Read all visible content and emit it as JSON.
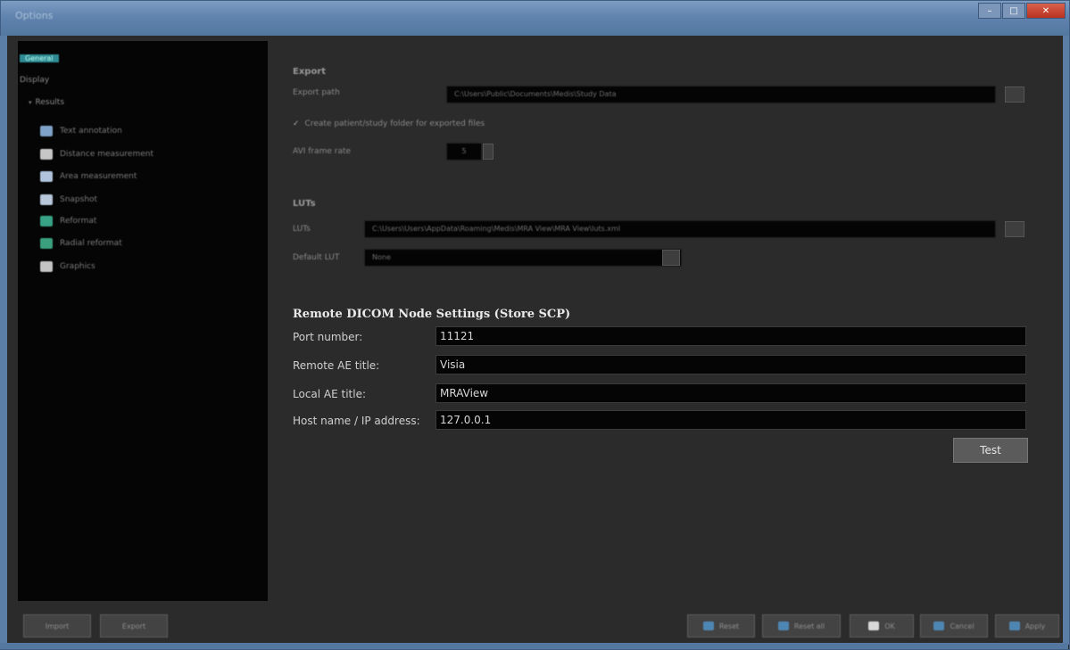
{
  "window": {
    "title": "Options"
  },
  "sidebar": {
    "top_items": [
      {
        "label": "General"
      },
      {
        "label": "Display"
      },
      {
        "label": "Results"
      }
    ],
    "sub_items": [
      {
        "label": "Text annotation",
        "icon": "text-annotation-icon",
        "color": "#7fa3c8"
      },
      {
        "label": "Distance measurement",
        "icon": "ruler-icon",
        "color": "#c7c7c7"
      },
      {
        "label": "Area measurement",
        "icon": "area-icon",
        "color": "#b0c4dc"
      },
      {
        "label": "Snapshot",
        "icon": "snapshot-icon",
        "color": "#b8c8da"
      },
      {
        "label": "Reformat",
        "icon": "reformat-icon",
        "color": "#38a386"
      },
      {
        "label": "Radial reformat",
        "icon": "radial-reformat-icon",
        "color": "#3aa07e"
      },
      {
        "label": "Graphics",
        "icon": "graphics-icon",
        "color": "#c4c4c4"
      }
    ]
  },
  "export": {
    "section_title": "Export",
    "path_label": "Export path",
    "path_value": "C:\\Users\\Public\\Documents\\Medis\\Study Data",
    "checkbox_label": "Create patient/study folder for exported files",
    "fps_label": "AVI frame rate",
    "fps_value": "5"
  },
  "luts": {
    "section_title": "LUTs",
    "luts_label": "LUTs",
    "luts_value": "C:\\Users\\Users\\AppData\\Roaming\\Medis\\MRA View\\MRA View\\luts.xml",
    "default_label": "Default LUT",
    "default_value": "None"
  },
  "remote": {
    "title": "Remote DICOM Node Settings (Store SCP)",
    "fields": [
      {
        "label": "Port number:",
        "value": "11121"
      },
      {
        "label": "Remote AE title:",
        "value": "Visia"
      },
      {
        "label": "Local AE title:",
        "value": "MRAView"
      },
      {
        "label": "Host name / IP address:",
        "value": "127.0.0.1"
      }
    ],
    "test_label": "Test"
  },
  "footer": {
    "left_buttons": [
      {
        "label": "Import"
      },
      {
        "label": "Export"
      }
    ],
    "right_buttons": [
      {
        "label": "Reset",
        "color": "#4e86b3"
      },
      {
        "label": "Reset all",
        "color": "#4e86b3"
      },
      {
        "label": "OK",
        "color": "#d8d8d8"
      },
      {
        "label": "Cancel",
        "color": "#4e86b3"
      },
      {
        "label": "Apply",
        "color": "#4e86b3"
      }
    ]
  },
  "colors": {
    "accent": "#2f8c95",
    "panel": "#2b2b2b",
    "sidebar": "#050505"
  }
}
